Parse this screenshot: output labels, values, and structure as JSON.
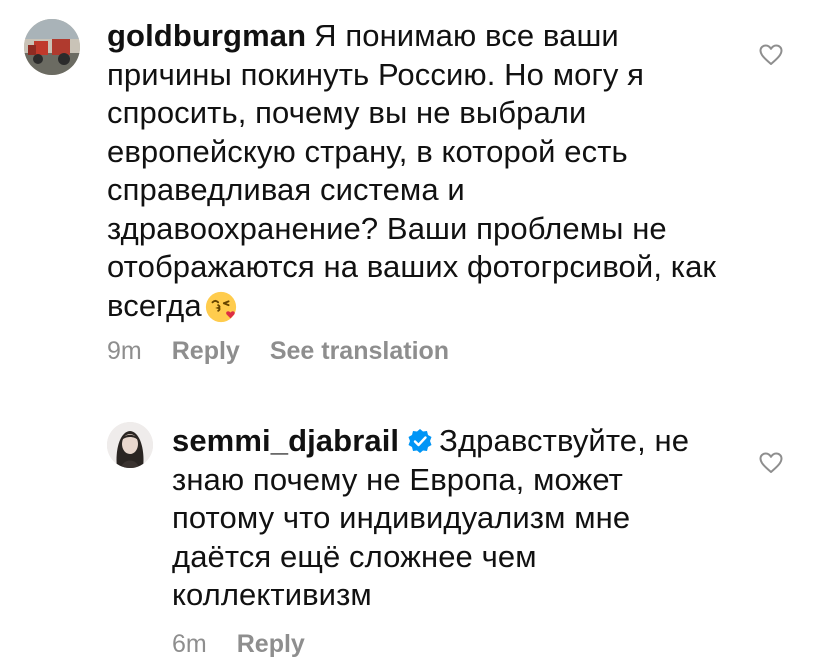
{
  "comments": [
    {
      "username": "goldburgman",
      "verified": false,
      "text": "Я понимаю все ваши причины покинуть Россию. Но могу я спросить, почему вы не выбрали европейскую страну, в которой есть справедливая система и здравоохранение? Ваши проблемы не отображаются на ваших фотогрсивой, как всегда",
      "emoji": "kissing-face-with-heart-emoji",
      "time": "9m",
      "reply_label": "Reply",
      "translate_label": "See translation",
      "like_icon": "heart-outline-icon"
    },
    {
      "username": "semmi_djabrail",
      "verified": true,
      "text": "Здравствуйте, не знаю почему не Европа, может потому что индивидуализм мне даётся ещё сложнее чем коллективизм",
      "time": "6m",
      "reply_label": "Reply",
      "like_icon": "heart-outline-icon"
    }
  ],
  "colors": {
    "text": "#111111",
    "meta": "#8e8e8e",
    "verified_badge": "#0095f6"
  }
}
